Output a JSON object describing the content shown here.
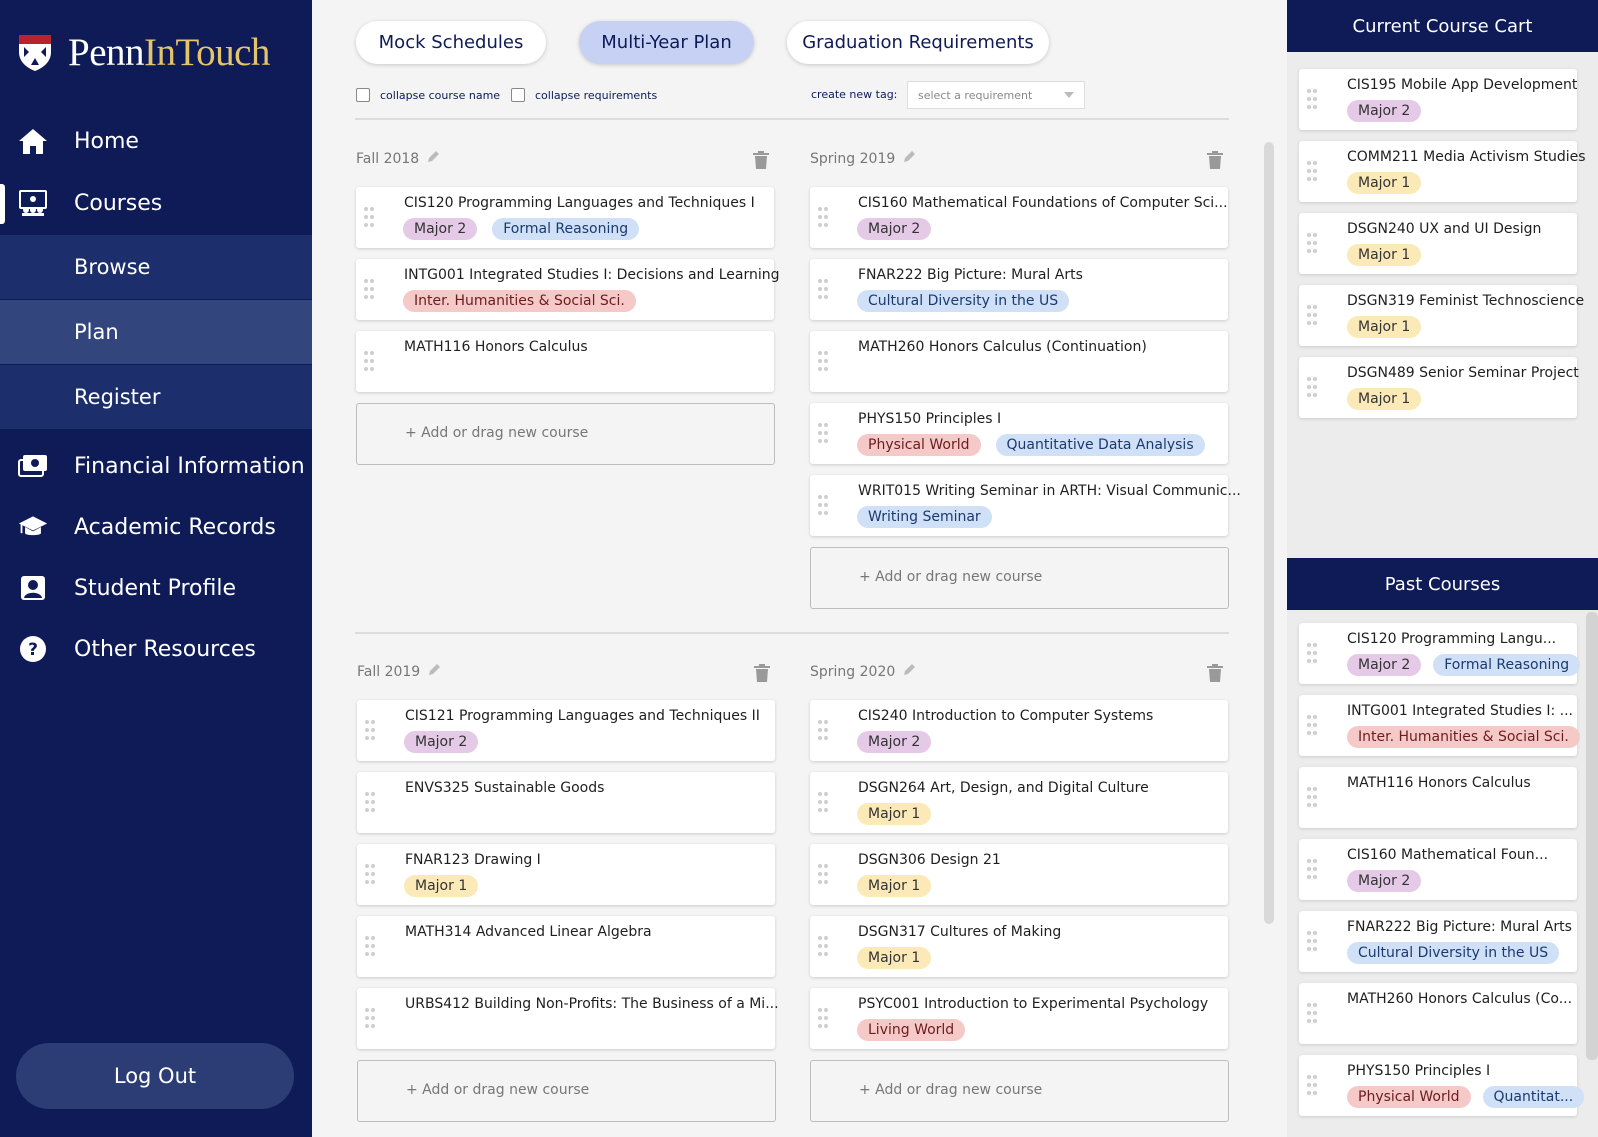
{
  "app": {
    "brand_penn": "Penn",
    "brand_intouch": "InTouch"
  },
  "nav": {
    "home": "Home",
    "courses": "Courses",
    "browse": "Browse",
    "plan": "Plan",
    "register": "Register",
    "financial": "Financial Information",
    "academic": "Academic Records",
    "profile": "Student Profile",
    "other": "Other Resources",
    "logout": "Log Out"
  },
  "tabs": {
    "mock": "Mock Schedules",
    "multiyear": "Multi-Year Plan",
    "grad": "Graduation Requirements"
  },
  "options": {
    "collapse_name": "collapse course name",
    "collapse_req": "collapse requirements",
    "new_tag_label": "create new tag:",
    "select_placeholder": "select a requirement"
  },
  "add_label": "+ Add or drag new course",
  "colors": {
    "navy": "#0e1b57",
    "major2": "#e4cae7",
    "major1": "#fbeab8",
    "blue_tag": "#cfe0f7",
    "red_tag": "#f6c9c9"
  },
  "semesters": {
    "fall2018": {
      "name": "Fall 2018",
      "courses": [
        {
          "title": "CIS120 Programming Languages and Techniques I",
          "tags": [
            "Major 2",
            "Formal Reasoning"
          ]
        },
        {
          "title": "INTG001 Integrated Studies I: Decisions and Learning",
          "tags": [
            "Inter. Humanities & Social Sci."
          ]
        },
        {
          "title": "MATH116 Honors Calculus",
          "tags": []
        }
      ]
    },
    "spring2019": {
      "name": "Spring 2019",
      "courses": [
        {
          "title": "CIS160 Mathematical Foundations of Computer Sci...",
          "tags": [
            "Major 2"
          ]
        },
        {
          "title": "FNAR222 Big Picture: Mural Arts",
          "tags": [
            "Cultural Diversity in the US"
          ]
        },
        {
          "title": "MATH260 Honors Calculus (Continuation)",
          "tags": []
        },
        {
          "title": "PHYS150 Principles I",
          "tags": [
            "Physical World",
            "Quantitative Data Analysis"
          ]
        },
        {
          "title": "WRIT015 Writing Seminar in ARTH: Visual Communic...",
          "tags": [
            "Writing Seminar"
          ]
        }
      ]
    },
    "fall2019": {
      "name": "Fall 2019",
      "courses": [
        {
          "title": "CIS121 Programming Languages and Techniques II",
          "tags": [
            "Major 2"
          ]
        },
        {
          "title": "ENVS325 Sustainable Goods",
          "tags": []
        },
        {
          "title": "FNAR123 Drawing I",
          "tags": [
            "Major 1"
          ]
        },
        {
          "title": "MATH314 Advanced Linear Algebra",
          "tags": []
        },
        {
          "title": "URBS412 Building Non-Profits: The Business of a Mi...",
          "tags": []
        }
      ]
    },
    "spring2020": {
      "name": "Spring 2020",
      "courses": [
        {
          "title": "CIS240 Introduction to Computer Systems",
          "tags": [
            "Major 2"
          ]
        },
        {
          "title": "DSGN264 Art, Design, and Digital Culture",
          "tags": [
            "Major 1"
          ]
        },
        {
          "title": "DSGN306 Design 21",
          "tags": [
            "Major 1"
          ]
        },
        {
          "title": "DSGN317 Cultures of Making",
          "tags": [
            "Major 1"
          ]
        },
        {
          "title": "PSYC001 Introduction to Experimental Psychology",
          "tags": [
            "Living World"
          ]
        }
      ]
    }
  },
  "cart": {
    "title": "Current Course Cart",
    "courses": [
      {
        "title": "CIS195 Mobile App Development",
        "tags": [
          "Major 2"
        ]
      },
      {
        "title": "COMM211 Media Activism Studies",
        "tags": [
          "Major 1"
        ]
      },
      {
        "title": "DSGN240 UX and UI Design",
        "tags": [
          "Major 1"
        ]
      },
      {
        "title": "DSGN319 Feminist Technoscience",
        "tags": [
          "Major 1"
        ]
      },
      {
        "title": "DSGN489 Senior Seminar Project",
        "tags": [
          "Major 1"
        ]
      }
    ]
  },
  "past": {
    "title": "Past Courses",
    "courses": [
      {
        "title": "CIS120 Programming Langu...",
        "tags": [
          "Major 2",
          "Formal Reasoning"
        ]
      },
      {
        "title": "INTG001 Integrated Studies I: ...",
        "tags": [
          "Inter. Humanities & Social Sci."
        ]
      },
      {
        "title": "MATH116 Honors Calculus",
        "tags": []
      },
      {
        "title": "CIS160 Mathematical Foun...",
        "tags": [
          "Major 2"
        ]
      },
      {
        "title": "FNAR222 Big Picture: Mural Arts",
        "tags": [
          "Cultural Diversity in the US"
        ]
      },
      {
        "title": "MATH260 Honors Calculus (Co...",
        "tags": []
      },
      {
        "title": "PHYS150 Principles I",
        "tags": [
          "Physical World",
          "Quantitat..."
        ]
      }
    ]
  }
}
